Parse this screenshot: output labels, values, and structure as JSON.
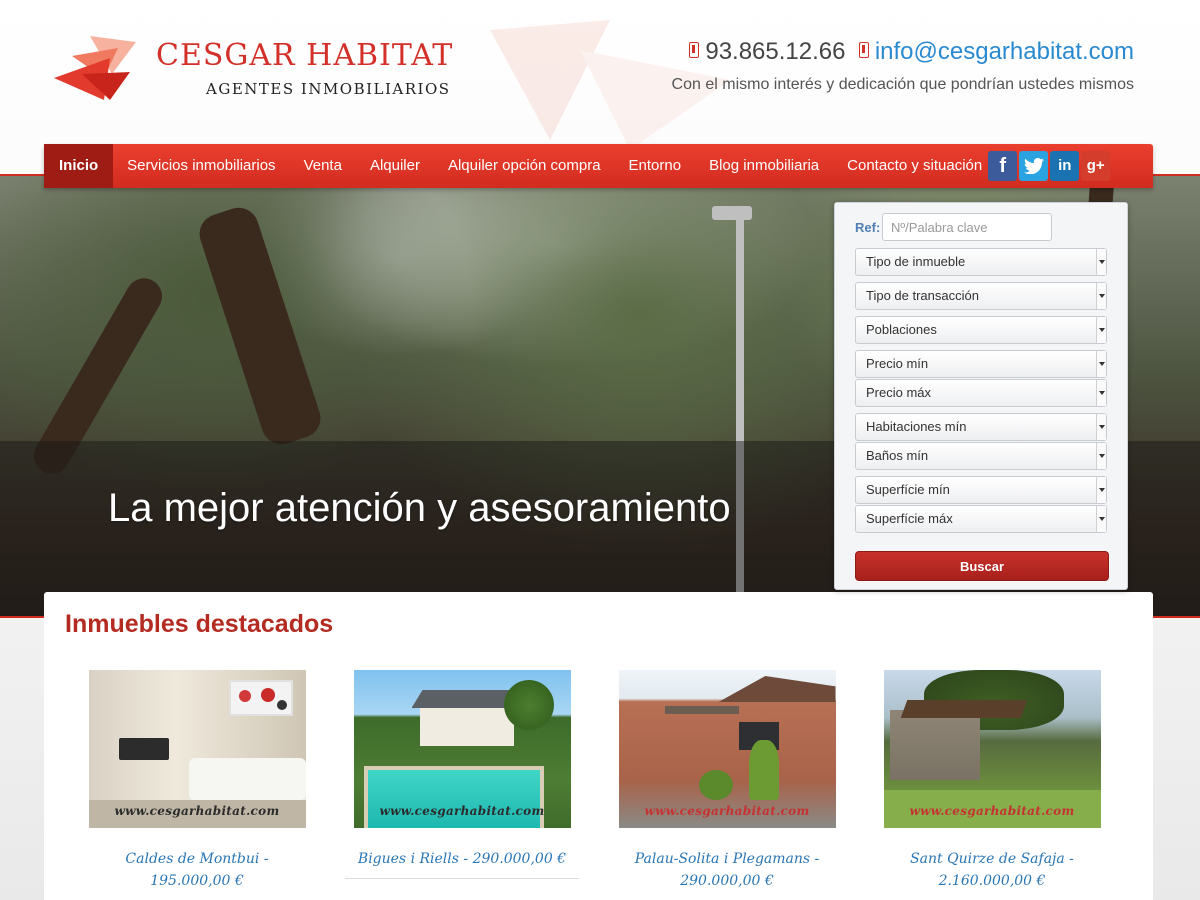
{
  "brand": {
    "name": "CESGAR HABITAT",
    "tagline": "AGENTES INMOBILIARIOS"
  },
  "contact": {
    "phone": "93.865.12.66",
    "email": "info@cesgarhabitat.com",
    "slogan": "Con el mismo interés y dedicación que pondrían ustedes mismos"
  },
  "nav": {
    "items": [
      {
        "label": "Inicio",
        "active": true
      },
      {
        "label": "Servicios inmobiliarios"
      },
      {
        "label": "Venta"
      },
      {
        "label": "Alquiler"
      },
      {
        "label": "Alquiler opción compra"
      },
      {
        "label": "Entorno"
      },
      {
        "label": "Blog inmobiliaria"
      },
      {
        "label": "Contacto y situación"
      }
    ],
    "social": [
      {
        "icon": "facebook-icon",
        "glyph": "f"
      },
      {
        "icon": "twitter-icon",
        "glyph": "t"
      },
      {
        "icon": "linkedin-icon",
        "glyph": "in"
      },
      {
        "icon": "google-plus-icon",
        "glyph": "g+"
      }
    ]
  },
  "hero": {
    "title": "La mejor atención y asesoramiento"
  },
  "search": {
    "ref_label": "Ref:",
    "ref_placeholder": "Nº/Palabra clave",
    "selects": [
      "Tipo de inmueble",
      "Tipo de transacción",
      "Poblaciones",
      "Precio mín",
      "Precio máx",
      "Habitaciones mín",
      "Baños mín",
      "Superfície mín",
      "Superfície máx"
    ],
    "button": "Buscar"
  },
  "featured": {
    "title": "Inmuebles destacados",
    "watermark": "www.cesgarhabitat.com",
    "cards": [
      {
        "caption": "Caldes de Montbui - 195.000,00 €"
      },
      {
        "caption": "Bigues i Riells - 290.000,00 €"
      },
      {
        "caption": "Palau-Solita i Plegamans - 290.000,00 €"
      },
      {
        "caption": "Sant Quirze de Safaja - 2.160.000,00 €"
      }
    ]
  },
  "colors": {
    "brand_red": "#d3302a",
    "nav_red": "#e23a2c",
    "active_nav": "#9e1c13",
    "link_blue": "#2a76b4",
    "heading_red": "#b42b22"
  }
}
